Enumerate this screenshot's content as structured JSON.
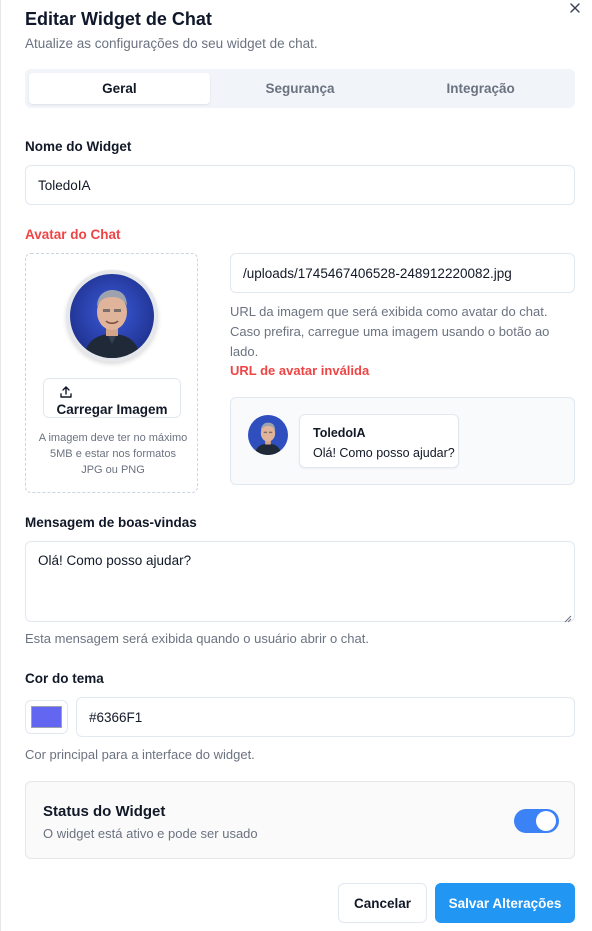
{
  "dialog": {
    "title": "Editar Widget de Chat",
    "subtitle": "Atualize as configurações do seu widget de chat."
  },
  "tabs": [
    {
      "label": "Geral",
      "active": true
    },
    {
      "label": "Segurança",
      "active": false
    },
    {
      "label": "Integração",
      "active": false
    }
  ],
  "widget_name": {
    "label": "Nome do Widget",
    "value": "ToledoIA"
  },
  "avatar": {
    "label": "Avatar do Chat",
    "upload_label": "Carregar Imagem",
    "upload_note": "A imagem deve ter no máximo 5MB e estar nos formatos JPG ou PNG",
    "url_value": "/uploads/1745467406528-248912220082.jpg",
    "url_help": "URL da imagem que será exibida como avatar do chat. Caso prefira, carregue uma imagem usando o botão ao lado.",
    "url_error": "URL de avatar inválida"
  },
  "preview": {
    "name": "ToledoIA",
    "message": "Olá! Como posso ajudar?"
  },
  "welcome": {
    "label": "Mensagem de boas-vindas",
    "value": "Olá! Como posso ajudar?",
    "help": "Esta mensagem será exibida quando o usuário abrir o chat."
  },
  "theme": {
    "label": "Cor do tema",
    "value": "#6366F1",
    "color": "#6366F1",
    "help": "Cor principal para a interface do widget."
  },
  "status": {
    "title": "Status do Widget",
    "description": "O widget está ativo e pode ser usado",
    "enabled": true
  },
  "actions": {
    "cancel_label": "Cancelar",
    "save_label": "Salvar Alterações"
  },
  "icons": {
    "close": "close-icon",
    "upload": "upload-icon",
    "resize": "resize-handle-icon"
  },
  "colors": {
    "accent": "#2196F3",
    "toggle_on": "#3B82F6",
    "error": "#EF4444"
  }
}
